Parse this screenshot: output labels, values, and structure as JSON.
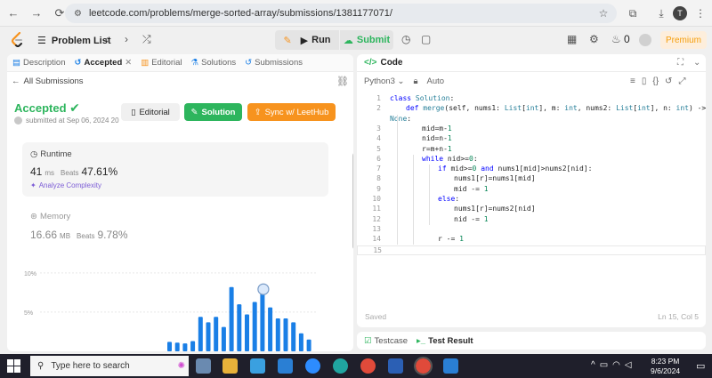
{
  "browser": {
    "url": "leetcode.com/problems/merge-sorted-array/submissions/1381177071/",
    "profile_initial": "T"
  },
  "topbar": {
    "problem_list": "Problem List",
    "run": "Run",
    "submit": "Submit",
    "fire_count": "0",
    "premium": "Premium"
  },
  "left": {
    "tabs": [
      {
        "label": "Description"
      },
      {
        "label": "Accepted"
      },
      {
        "label": "Editorial"
      },
      {
        "label": "Solutions"
      },
      {
        "label": "Submissions"
      }
    ],
    "back_label": "All Submissions",
    "status": "Accepted",
    "submitted": "submitted at Sep 06, 2024 20",
    "buttons": {
      "editorial": "Editorial",
      "solution": "Solution",
      "sync": "Sync w/ LeetHub"
    },
    "runtime": {
      "label": "Runtime",
      "value": "41",
      "unit": "ms",
      "beats_label": "Beats",
      "beats": "47.61%",
      "analyze": "Analyze Complexity"
    },
    "memory": {
      "label": "Memory",
      "value": "16.66",
      "unit": "MB",
      "beats_label": "Beats",
      "beats": "9.78%"
    }
  },
  "chart_data": {
    "type": "bar",
    "y_tick_labels": [
      "10%",
      "5%"
    ],
    "ylim": [
      0,
      11
    ],
    "values": [
      1.2,
      1.1,
      1.0,
      1.3,
      4.4,
      3.7,
      4.4,
      3.1,
      8.2,
      6.0,
      4.7,
      6.3,
      7.8,
      5.6,
      4.2,
      4.2,
      3.7,
      2.3,
      1.5
    ],
    "highlight_index": 12,
    "color": "#1a7fe6",
    "grid": true
  },
  "editor": {
    "title": "Code",
    "language": "Python3",
    "mode": "Auto",
    "lines": [
      {
        "n": "1",
        "text": "class Solution:",
        "indent": 0
      },
      {
        "n": "2",
        "text": "def merge(self, nums1: List[int], m: int, nums2: List[int], n: int) ->",
        "indent": 1
      },
      {
        "n": "",
        "text": "None:",
        "indent": 0
      },
      {
        "n": "3",
        "text": "mid=m-1",
        "indent": 2
      },
      {
        "n": "4",
        "text": "nid=n-1",
        "indent": 2
      },
      {
        "n": "5",
        "text": "r=m+n-1",
        "indent": 2
      },
      {
        "n": "6",
        "text": "while nid>=0:",
        "indent": 2
      },
      {
        "n": "7",
        "text": "if mid>=0 and nums1[mid]>nums2[nid]:",
        "indent": 3
      },
      {
        "n": "8",
        "text": "nums1[r]=nums1[mid]",
        "indent": 4
      },
      {
        "n": "9",
        "text": "mid -= 1",
        "indent": 4
      },
      {
        "n": "10",
        "text": "else:",
        "indent": 3
      },
      {
        "n": "11",
        "text": "nums1[r]=nums2[nid]",
        "indent": 4
      },
      {
        "n": "12",
        "text": "nid -= 1",
        "indent": 4
      },
      {
        "n": "13",
        "text": "",
        "indent": 0
      },
      {
        "n": "14",
        "text": "r -= 1",
        "indent": 3
      },
      {
        "n": "15",
        "text": "",
        "indent": 0
      }
    ],
    "saved": "Saved",
    "position": "Ln 15, Col 5"
  },
  "bottom": {
    "testcase": "Testcase",
    "result": "Test Result"
  },
  "taskbar": {
    "search": "Type here to search",
    "time": "8:23 PM",
    "date": "9/6/2024"
  }
}
